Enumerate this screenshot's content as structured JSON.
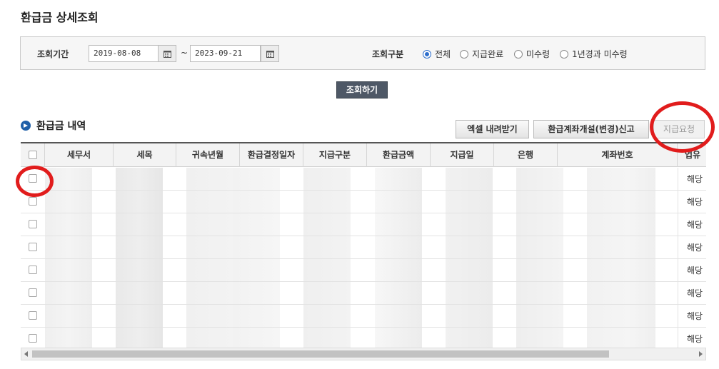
{
  "page": {
    "title": "환급금 상세조회"
  },
  "search": {
    "period_label": "조회기간",
    "start_date": "2019-08-08",
    "separator": "~",
    "end_date": "2023-09-21",
    "type_label": "조회구분",
    "options": [
      {
        "label": "전체",
        "checked": true
      },
      {
        "label": "지급완료",
        "checked": false
      },
      {
        "label": "미수령",
        "checked": false
      },
      {
        "label": "1년경과 미수령",
        "checked": false
      }
    ],
    "submit_label": "조회하기"
  },
  "section": {
    "title": "환급금 내역",
    "buttons": {
      "excel": "엑셀 내려받기",
      "account": "환급계좌개설(변경)신고",
      "request": "지급요청"
    }
  },
  "table": {
    "columns": [
      "세무서",
      "세목",
      "귀속년월",
      "환급결정일자",
      "지급구분",
      "환급금액",
      "지급일",
      "은행",
      "계좌번호",
      "업유"
    ],
    "last_col_values": [
      "해당",
      "해당",
      "해당",
      "해당",
      "해당",
      "해당",
      "해당",
      "해당"
    ]
  },
  "colors": {
    "accent": "#2d6ecc",
    "primary_button": "#4e5866",
    "highlight_circle": "#e11c1c"
  }
}
